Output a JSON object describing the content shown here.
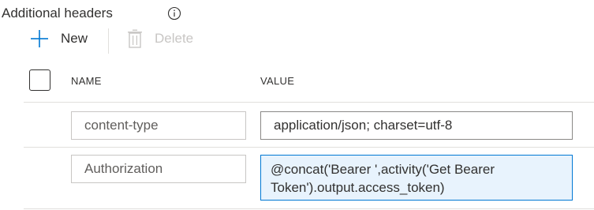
{
  "section": {
    "title": "Additional headers",
    "info_icon": "info-icon"
  },
  "toolbar": {
    "new_label": "New",
    "new_icon": "plus-icon",
    "delete_label": "Delete",
    "delete_icon": "trash-icon"
  },
  "table": {
    "columns": [
      "NAME",
      "VALUE"
    ],
    "rows": [
      {
        "name": "content-type",
        "value": "application/json; charset=utf-8"
      },
      {
        "name": "Authorization",
        "value": "@concat('Bearer ',activity('Get Bearer\nToken').output.access_token)"
      }
    ]
  },
  "colors": {
    "accent": "#0078d4",
    "disabled": "#c8c6c4",
    "focused_field_bg": "#e8f3fd"
  }
}
